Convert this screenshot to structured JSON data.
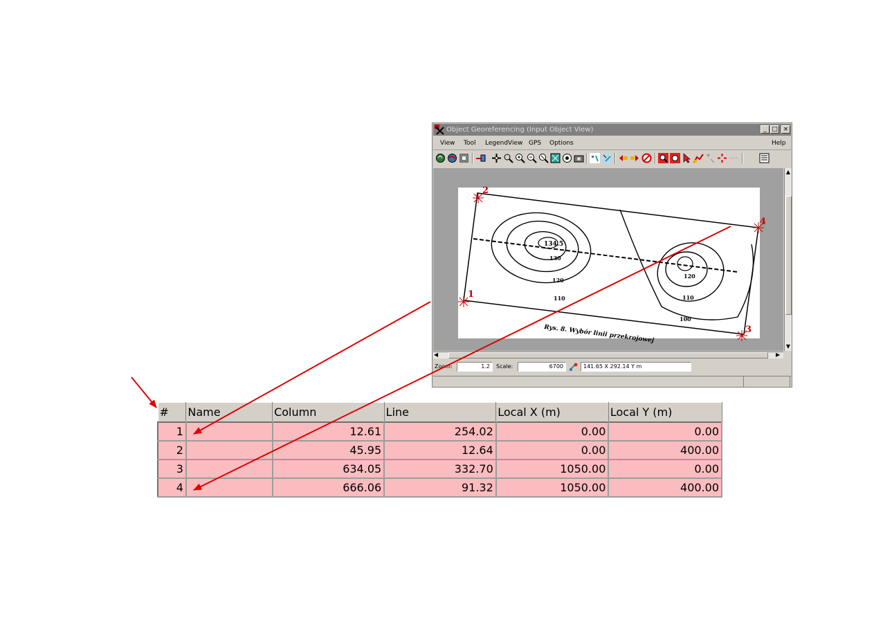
{
  "window": {
    "title": "Object Georeferencing (Input Object View)",
    "menu": [
      "View",
      "Tool",
      "LegendView",
      "GPS",
      "Options"
    ],
    "help": "Help"
  },
  "map": {
    "point_labels": [
      "1",
      "2",
      "3",
      "4"
    ],
    "contour_labels": [
      "134.5",
      "130",
      "120",
      "110",
      "120",
      "110",
      "100"
    ],
    "caption": "Rys. 8. Wybór linii przekrojowej"
  },
  "statusbar": {
    "zoom_label": "Zoom:",
    "zoom_value": "1.2",
    "scale_label": "Scale:",
    "scale_value": "6700",
    "coords": "141.65 X  292.14 Y m"
  },
  "table": {
    "headers": [
      "#",
      "Name",
      "Column",
      "Line",
      "Local X (m)",
      "Local Y (m)"
    ],
    "rows": [
      [
        "1",
        "",
        "12.61",
        "254.02",
        "0.00",
        "0.00"
      ],
      [
        "2",
        "",
        "45.95",
        "12.64",
        "0.00",
        "400.00"
      ],
      [
        "3",
        "",
        "634.05",
        "332.70",
        "1050.00",
        "0.00"
      ],
      [
        "4",
        "",
        "666.06",
        "91.32",
        "1050.00",
        "400.00"
      ]
    ]
  },
  "colors": {
    "arrow": "#e00000",
    "row_bg": "#fbbcc0",
    "marker": "#cc0000"
  }
}
